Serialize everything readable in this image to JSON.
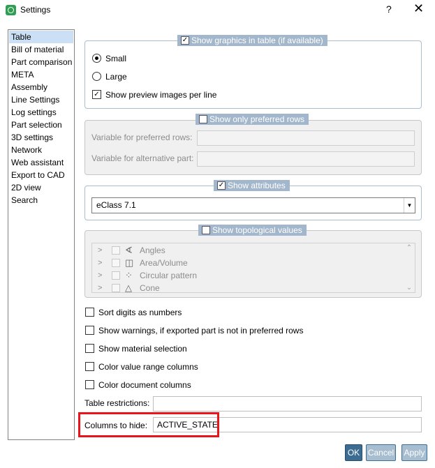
{
  "window": {
    "title": "Settings",
    "help": "?",
    "close": "✕"
  },
  "nav": {
    "items": [
      "Table",
      "Bill of material",
      "Part comparison",
      "META",
      "Assembly",
      "Line Settings",
      "Log settings",
      "Part selection",
      "3D settings",
      "Network",
      "Web assistant",
      "Export to CAD",
      "2D view",
      "Search"
    ],
    "selected": "Table"
  },
  "graphics_group": {
    "legend": "Show graphics in table (if available)",
    "checked": true,
    "small_label": "Small",
    "large_label": "Large",
    "selected_size": "Small",
    "preview_label": "Show preview images per line",
    "preview_checked": true
  },
  "preferred_group": {
    "legend": "Show only preferred rows",
    "checked": false,
    "var_preferred_label": "Variable for preferred rows:",
    "var_preferred_value": "",
    "var_alt_label": "Variable for alternative part:",
    "var_alt_value": ""
  },
  "attributes_group": {
    "legend": "Show attributes",
    "checked": true,
    "selected": "eClass 7.1"
  },
  "topo_group": {
    "legend": "Show topological values",
    "checked": false,
    "items": [
      {
        "label": "Angles",
        "icon": "angle-icon"
      },
      {
        "label": "Area/Volume",
        "icon": "area-volume-icon"
      },
      {
        "label": "Circular pattern",
        "icon": "circular-pattern-icon"
      },
      {
        "label": "Cone",
        "icon": "cone-icon"
      }
    ]
  },
  "options": {
    "sort_digits": "Sort digits as numbers",
    "show_warnings": "Show warnings, if exported part is not in preferred rows",
    "show_material": "Show material selection",
    "color_value_range": "Color value range columns",
    "color_document": "Color document columns"
  },
  "restrictions": {
    "table_restrictions_label": "Table restrictions:",
    "table_restrictions_value": "",
    "columns_hide_label": "Columns to hide:",
    "columns_hide_value": "ACTIVE_STATE"
  },
  "buttons": {
    "ok": "OK",
    "cancel": "Cancel",
    "apply": "Apply"
  },
  "colors": {
    "legend_bg": "#a3b7cc",
    "highlight": "#e8151b",
    "primary_button": "#3d6c93"
  }
}
